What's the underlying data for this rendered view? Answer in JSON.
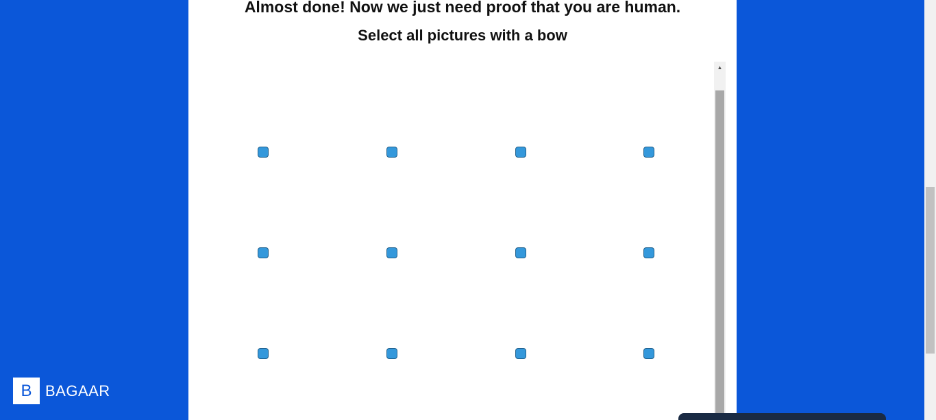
{
  "page": {
    "headline": "Almost done! Now we just need proof that you are human.",
    "instruction": "Select all pictures with a bow"
  },
  "captcha": {
    "checkboxes": [
      {
        "row": 1,
        "col": 1,
        "checked": false
      },
      {
        "row": 1,
        "col": 2,
        "checked": false
      },
      {
        "row": 1,
        "col": 3,
        "checked": false
      },
      {
        "row": 1,
        "col": 4,
        "checked": false
      },
      {
        "row": 2,
        "col": 1,
        "checked": false
      },
      {
        "row": 2,
        "col": 2,
        "checked": false
      },
      {
        "row": 2,
        "col": 3,
        "checked": false
      },
      {
        "row": 2,
        "col": 4,
        "checked": false
      },
      {
        "row": 3,
        "col": 1,
        "checked": false
      },
      {
        "row": 3,
        "col": 2,
        "checked": false
      },
      {
        "row": 3,
        "col": 3,
        "checked": false
      },
      {
        "row": 3,
        "col": 4,
        "checked": false
      }
    ]
  },
  "logo": {
    "mark": "B",
    "name": "BAGAAR"
  },
  "colors": {
    "background": "#0b57d9",
    "checkbox": "#3498db",
    "panel": "#ffffff",
    "chat_widget": "#1a2b44"
  }
}
